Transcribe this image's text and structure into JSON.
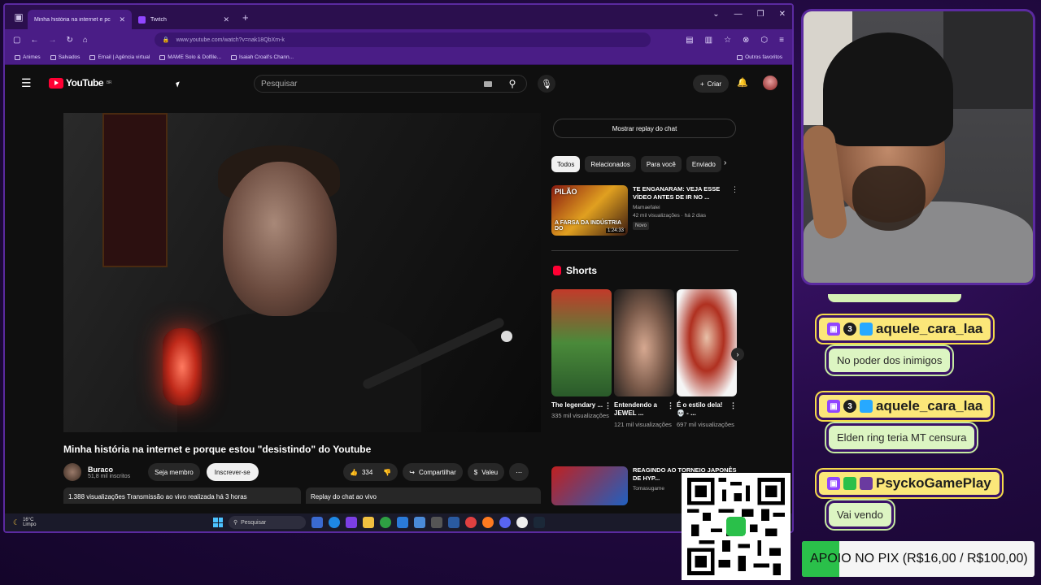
{
  "browser": {
    "tabs": [
      {
        "label": "Minha história na internet e pc",
        "active": true,
        "favicon": "youtube-icon"
      },
      {
        "label": "Twitch",
        "active": false,
        "favicon": "twitch-icon"
      }
    ],
    "url": "www.youtube.com/watch?v=nak18QbXm-k",
    "bookmarks": [
      "Animes",
      "Salvados",
      "Email | Agência virtual",
      "MAME Solo & Dolfile...",
      "Isaiah Croall's Chann..."
    ],
    "bookmarks_other": "Outros favoritos"
  },
  "youtube": {
    "logo_text": "YouTube",
    "logo_region": "BR",
    "search_placeholder": "Pesquisar",
    "create_label": "Criar",
    "video": {
      "title": "Minha história na internet e porque estou \"desistindo\" do Youtube",
      "channel": "Buraco",
      "subscribers": "51,8 mil inscritos",
      "member_label": "Seja membro",
      "subscribe_label": "Inscrever-se",
      "likes": "334",
      "share_label": "Compartilhar",
      "thanks_label": "Valeu",
      "views": "1.388 visualizações",
      "live_info": "Transmissão ao vivo realizada há 3 horas",
      "chat_replay_box": "Replay do chat ao vivo"
    },
    "sidebar": {
      "chat_replay_button": "Mostrar replay do chat",
      "chips": [
        "Todos",
        "Relacionados",
        "Para você",
        "Enviado"
      ],
      "recommendation": {
        "title": "TE ENGANARAM: VEJA ESSE VÍDEO ANTES DE IR NO ...",
        "channel": "Mamaefalei",
        "meta": "42 mil visualizações · há 2 dias",
        "badge": "Novo",
        "duration": "1:24:33",
        "thumb_caption_top": "PILÃO",
        "thumb_caption": "A FARSA DA INDÚSTRIA DO"
      },
      "shorts_title": "Shorts",
      "shorts": [
        {
          "title": "The legendary ...",
          "views": "335 mil visualizações"
        },
        {
          "title": "Entendendo a JEWEL ...",
          "views": "121 mil visualizações"
        },
        {
          "title": "É o estilo dela! 💀 - ...",
          "views": "697 mil visualizações"
        }
      ],
      "recommendation2": {
        "title": "REAGINDO AO TORNEIO JAPONÊS DE HYP...",
        "channel": "Tomasugame"
      }
    }
  },
  "taskbar": {
    "temp": "16°C",
    "weather": "Limpo",
    "search": "Pesquisar"
  },
  "chat": [
    {
      "user": "aquele_cara_laa",
      "message": "No poder dos inimigos"
    },
    {
      "user": "aquele_cara_laa",
      "message": "Elden ring teria MT censura"
    },
    {
      "user": "PsyckoGamePlay",
      "message": "Vai vendo"
    }
  ],
  "pix": {
    "text": "APOIO NO PIX (R$16,00 / R$100,00)",
    "raised": 16,
    "goal": 100
  },
  "colors": {
    "youtube_red": "#ff0033",
    "twitch_purple": "#9146ff",
    "chat_name_bg": "#fbe779",
    "chat_text_bg": "#dcf5c2",
    "pix_green": "#2ac04a"
  }
}
